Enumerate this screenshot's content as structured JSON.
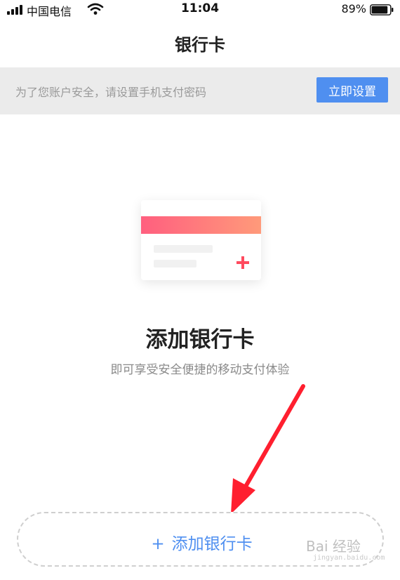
{
  "status_bar": {
    "carrier": "中国电信",
    "time": "11:04",
    "battery_percent": "89%",
    "battery_level": 0.89
  },
  "nav": {
    "title": "银行卡"
  },
  "banner": {
    "text": "为了您账户安全，请设置手机支付密码",
    "button_label": "立即设置",
    "button_color": "#4f8ff0"
  },
  "empty_state": {
    "title": "添加银行卡",
    "subtitle": "即可享受安全便捷的移动支付体验"
  },
  "add_button": {
    "plus": "+",
    "label": "添加银行卡"
  },
  "annotation": {
    "arrow_color": "#ff1f2f"
  },
  "watermark": {
    "brand": "Bai 经验",
    "url": "jingyan.baidu.com"
  }
}
